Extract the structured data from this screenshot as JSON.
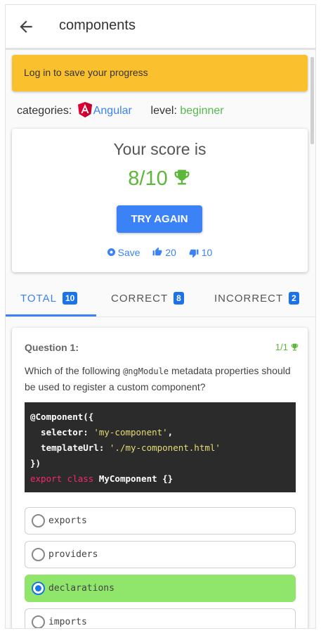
{
  "header": {
    "title": "components"
  },
  "banner": {
    "text": "Log in to save your progress"
  },
  "meta": {
    "categories_label": "categories:",
    "category": "Angular",
    "level_label": "level:",
    "level": "beginner"
  },
  "score": {
    "label": "Your score is",
    "value": "8/10",
    "try_again": "TRY AGAIN",
    "save": "Save",
    "likes": "20",
    "dislikes": "10"
  },
  "tabs": [
    {
      "label": "TOTAL",
      "count": "10"
    },
    {
      "label": "CORRECT",
      "count": "8"
    },
    {
      "label": "INCORRECT",
      "count": "2"
    }
  ],
  "question": {
    "title": "Question 1:",
    "score": "1/1",
    "text_before": "Which of the following ",
    "text_code": "@ngModule",
    "text_after": " metadata properties should be used to register a custom component?",
    "code": {
      "line1": "@Component({",
      "line2_key": "  selector: ",
      "line2_val": "'my-component'",
      "line2_end": ",",
      "line3_key": "  templateUrl: ",
      "line3_val": "'./my-component.html'",
      "line4": "})",
      "line5_kw": "export class ",
      "line5_name": "MyComponent {}"
    },
    "options": [
      {
        "label": "exports",
        "selected": false
      },
      {
        "label": "providers",
        "selected": false
      },
      {
        "label": "declarations",
        "selected": true
      },
      {
        "label": "imports",
        "selected": false
      }
    ]
  },
  "colors": {
    "accent": "#3b82f6",
    "banner": "#fbc02d",
    "success": "#5cb83a",
    "selected_option": "#8fe66a"
  }
}
